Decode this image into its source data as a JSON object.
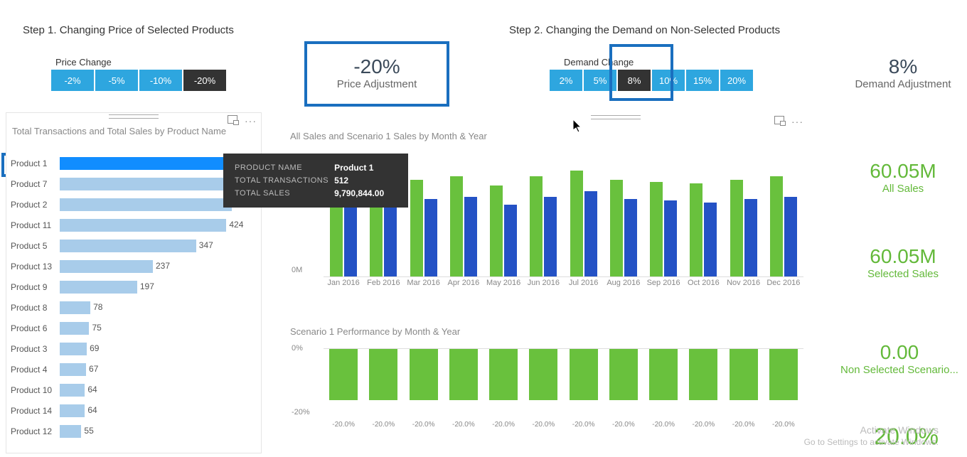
{
  "steps": {
    "step1": "Step 1. Changing Price of Selected Products",
    "step2": "Step 2. Changing the Demand on Non-Selected Products"
  },
  "price_slicer": {
    "label": "Price Change",
    "options": [
      "-2%",
      "-5%",
      "-10%",
      "-20%"
    ],
    "selected": "-20%"
  },
  "demand_slicer": {
    "label": "Demand Change",
    "options": [
      "2%",
      "5%",
      "8%",
      "10%",
      "15%",
      "20%"
    ],
    "selected": "8%"
  },
  "kpi_price": {
    "value": "-20%",
    "label": "Price Adjustment"
  },
  "kpi_demand": {
    "value": "8%",
    "label": "Demand Adjustment"
  },
  "kpi_all_sales": {
    "value": "60.05M",
    "label": "All Sales"
  },
  "kpi_sel_sales": {
    "value": "60.05M",
    "label": "Selected Sales"
  },
  "kpi_nonsel": {
    "value": "0.00",
    "label": "Non Selected Scenario..."
  },
  "big_pct": "20.0%",
  "product_panel": {
    "title": "Total Transactions and Total Sales by Product Name"
  },
  "tooltip": {
    "k1": "PRODUCT NAME",
    "v1": "Product 1",
    "k2": "TOTAL TRANSACTIONS",
    "v2": "512",
    "k3": "TOTAL SALES",
    "v3": "9,790,844.00"
  },
  "sales_panel": {
    "title": "All Sales and Scenario 1 Sales by Month & Year",
    "yzero": "0M"
  },
  "perf_panel": {
    "title": "Scenario 1 Performance by Month & Year",
    "yzero": "0%",
    "yneg": "-20%"
  },
  "watermark": {
    "line1": "Activate Windows",
    "line2": "Go to Settings to activate Windows."
  },
  "chart_data": [
    {
      "type": "bar",
      "title": "Total Transactions and Total Sales by Product Name",
      "xlabel": "",
      "ylabel": "",
      "categories": [
        "Product 1",
        "Product 7",
        "Product 2",
        "Product 11",
        "Product 5",
        "Product 13",
        "Product 9",
        "Product 8",
        "Product 6",
        "Product 3",
        "Product 4",
        "Product 10",
        "Product 14",
        "Product 12"
      ],
      "values": [
        512,
        470,
        438,
        424,
        347,
        237,
        197,
        78,
        75,
        69,
        67,
        64,
        64,
        55
      ],
      "selected": "Product 1"
    },
    {
      "type": "bar",
      "title": "All Sales and Scenario 1 Sales by Month & Year",
      "categories": [
        "Jan 2016",
        "Feb 2016",
        "Mar 2016",
        "Apr 2016",
        "May 2016",
        "Jun 2016",
        "Jul 2016",
        "Aug 2016",
        "Sep 2016",
        "Oct 2016",
        "Nov 2016",
        "Dec 2016"
      ],
      "series": [
        {
          "name": "All Sales",
          "values": [
            5.0,
            4.6,
            5.1,
            5.3,
            4.8,
            5.3,
            5.6,
            5.1,
            5.0,
            4.9,
            5.1,
            5.3
          ]
        },
        {
          "name": "Scenario 1 Sales",
          "values": [
            4.0,
            3.7,
            4.1,
            4.2,
            3.8,
            4.2,
            4.5,
            4.1,
            4.0,
            3.9,
            4.1,
            4.2
          ]
        }
      ],
      "ylabel": "0M",
      "ylim": [
        0,
        6
      ]
    },
    {
      "type": "bar",
      "title": "Scenario 1 Performance by Month & Year",
      "categories": [
        "Jan 2016",
        "Feb 2016",
        "Mar 2016",
        "Apr 2016",
        "May 2016",
        "Jun 2016",
        "Jul 2016",
        "Aug 2016",
        "Sep 2016",
        "Oct 2016",
        "Nov 2016",
        "Dec 2016"
      ],
      "values": [
        -20.0,
        -20.0,
        -20.0,
        -20.0,
        -20.0,
        -20.0,
        -20.0,
        -20.0,
        -20.0,
        -20.0,
        -20.0,
        -20.0
      ],
      "ylabel": "%",
      "ylim": [
        -25,
        0
      ]
    }
  ]
}
